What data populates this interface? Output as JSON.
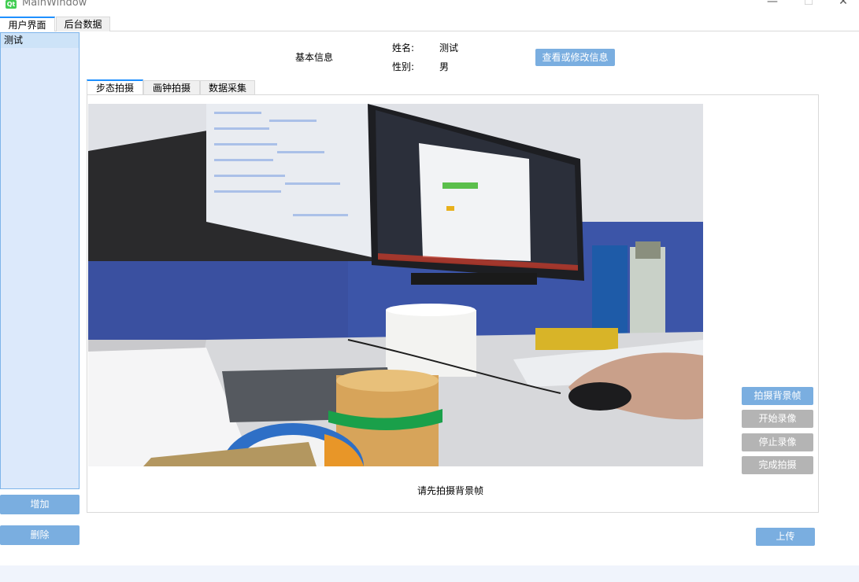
{
  "window": {
    "title": "MainWindow",
    "app_icon_text": "Qt"
  },
  "top_tabs": [
    "用户界面",
    "后台数据"
  ],
  "user_list": {
    "items": [
      "测试"
    ]
  },
  "left_buttons": {
    "add": "增加",
    "delete": "删除"
  },
  "basic_info": {
    "heading": "基本信息",
    "name_label": "姓名:",
    "name_value": "测试",
    "gender_label": "性别:",
    "gender_value": "男",
    "edit_button": "查看或修改信息"
  },
  "inner_tabs": [
    "步态拍摄",
    "画钟拍摄",
    "数据采集"
  ],
  "capture": {
    "status_text": "请先拍摄背景帧",
    "buttons": {
      "capture_background": "拍摄背景帧",
      "start_record": "开始录像",
      "stop_record": "停止录像",
      "finish": "完成拍摄"
    }
  },
  "upload_button": "上传",
  "colors": {
    "accent": "#7aaee0",
    "disabled": "#b4b4b4",
    "list_bg": "#dce9fb"
  }
}
